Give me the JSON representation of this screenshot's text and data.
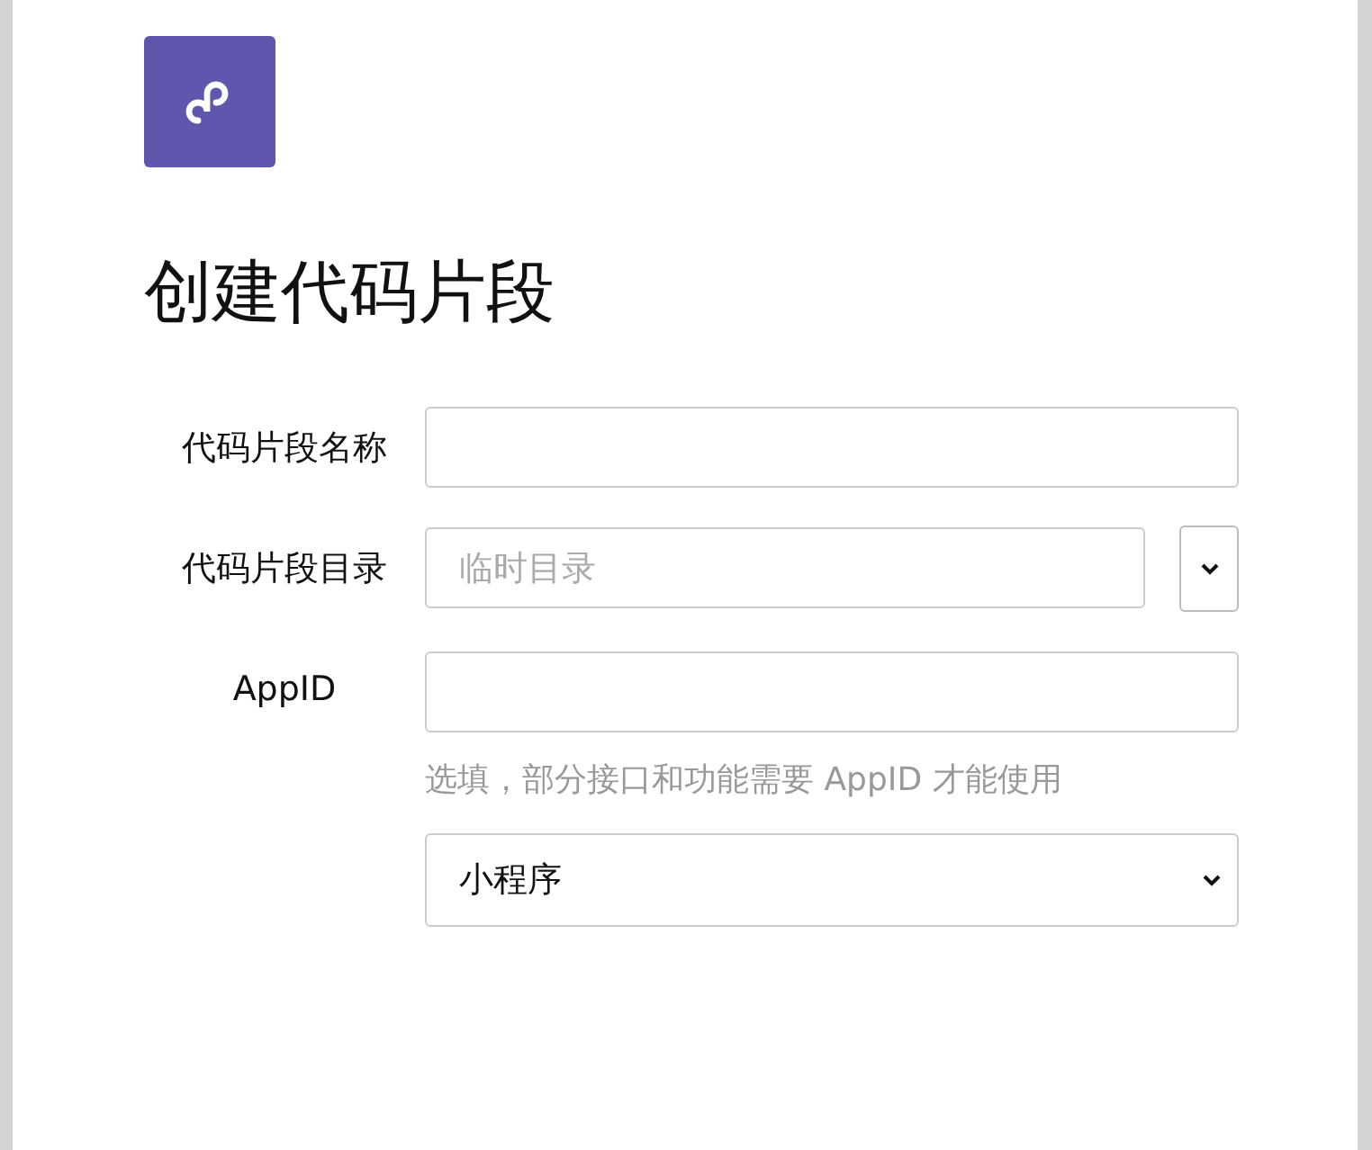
{
  "title": "创建代码片段",
  "fields": [
    {
      "kind": "text",
      "label": "代码片段名称"
    },
    {
      "kind": "combo",
      "label": "代码片段目录",
      "placeholder": "临时目录"
    },
    {
      "kind": "text",
      "label": "AppID",
      "hint": "选填，部分接口和功能需要 AppID 才能使用"
    },
    {
      "kind": "select",
      "value": "小程序"
    }
  ]
}
